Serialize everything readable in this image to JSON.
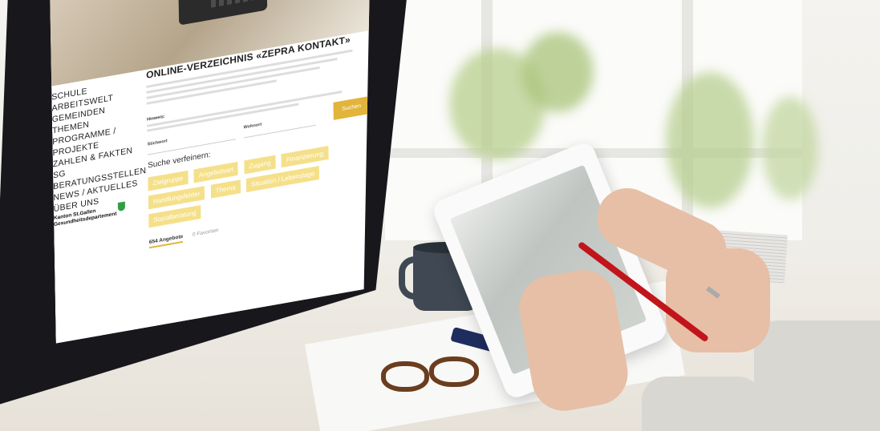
{
  "website": {
    "nav_items": [
      "SCHULE",
      "ARBEITSWELT",
      "GEMEINDEN",
      "THEMEN",
      "PROGRAMME / PROJEKTE",
      "ZAHLEN & FAKTEN SG",
      "BERATUNGSSTELLEN",
      "NEWS / AKTUELLES",
      "ÜBER UNS"
    ],
    "kanton_label": "Kanton St.Gallen Gesundheitsdepartement",
    "title": "ONLINE-VERZEICHNIS «ZEPRA KONTAKT»",
    "hinweis_label": "Hinweis:",
    "search_button": "Suchen",
    "stichwort_label": "Stichwort",
    "wohnort_label": "Wohnort",
    "refine_label": "Suche verfeinern:",
    "filter_chips": [
      "Zielgruppe",
      "Angebotsart",
      "Zugang",
      "Finanzierung",
      "Handlungsfelder",
      "Thema",
      "Situation / Lebenslage",
      "Sozialberatung"
    ],
    "tab_active": "654 Angebote",
    "tab_inactive": "0 Favoriten"
  },
  "colors": {
    "accent_yellow": "#e3b43a",
    "chip_yellow": "#f5e08a",
    "monitor_bezel": "#17171c",
    "stylus_red": "#c2141b",
    "mug": "#3f4853"
  }
}
